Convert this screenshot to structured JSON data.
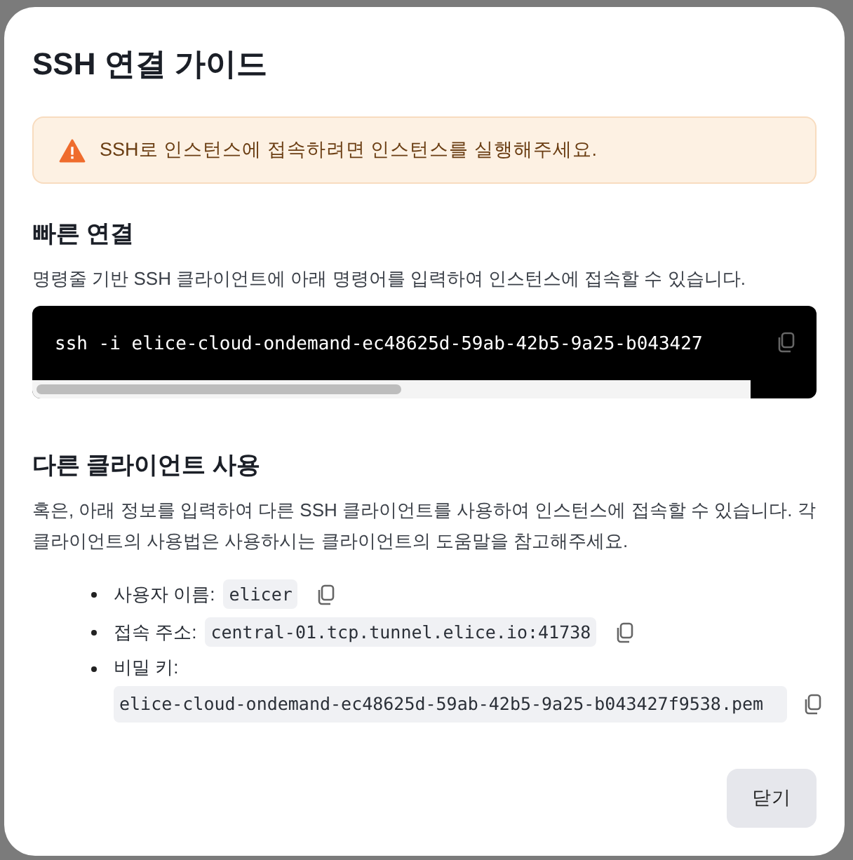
{
  "dialog": {
    "title": "SSH 연결 가이드"
  },
  "alert": {
    "kind": "warning",
    "message": "SSH로 인스턴스에 접속하려면 인스턴스를 실행해주세요."
  },
  "quick_connect": {
    "heading": "빠른 연결",
    "description": "명령줄 기반 SSH 클라이언트에 아래 명령어를 입력하여 인스턴스에 접속할 수 있습니다.",
    "command": "ssh -i elice-cloud-ondemand-ec48625d-59ab-42b5-9a25-b043427"
  },
  "other_clients": {
    "heading": "다른 클라이언트 사용",
    "description": "혹은, 아래 정보를 입력하여 다른 SSH 클라이언트를 사용하여 인스턴스에 접속할 수 있습니다. 각 클라이언트의 사용법은 사용하시는 클라이언트의 도움말을 참고해주세요.",
    "items": [
      {
        "label": "사용자 이름:",
        "value": "elicer",
        "kind": "inline"
      },
      {
        "label": "접속 주소:",
        "value": "central-01.tcp.tunnel.elice.io:41738",
        "kind": "inline"
      },
      {
        "label": "비밀 키:",
        "value": "elice-cloud-ondemand-ec48625d-59ab-42b5-9a25-b043427f9538.pem",
        "kind": "block"
      }
    ]
  },
  "buttons": [
    "닫기"
  ]
}
